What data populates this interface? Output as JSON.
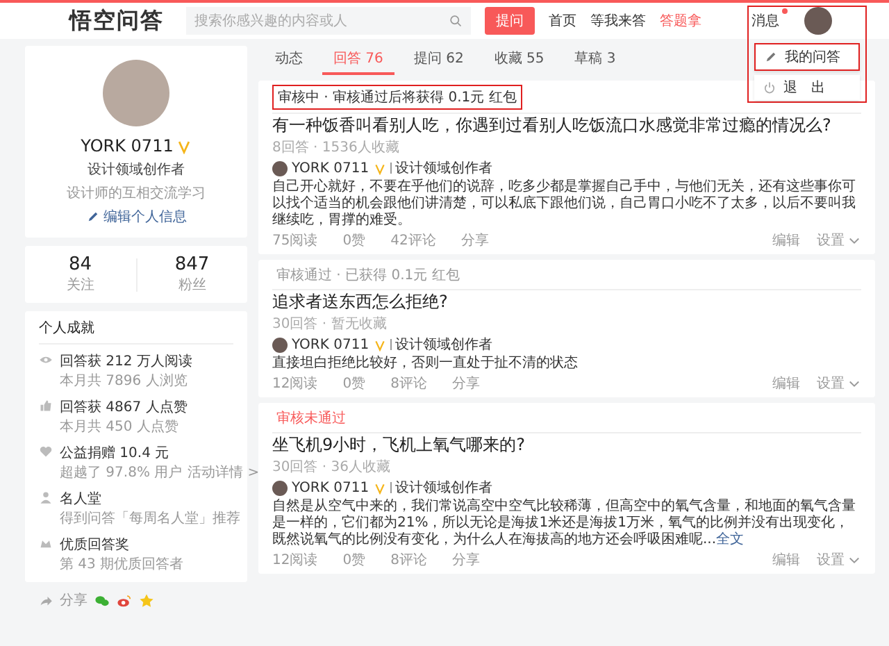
{
  "header": {
    "logo": "悟空问答",
    "search": {
      "placeholder": "搜索你感兴趣的内容或人"
    },
    "ask_button": "提问",
    "nav": [
      {
        "label": "首页",
        "highlight": false
      },
      {
        "label": "等我来答",
        "highlight": false
      },
      {
        "label": "答题拿",
        "highlight": true
      }
    ],
    "messages": {
      "label": "消息",
      "unread": true
    }
  },
  "user_menu": {
    "annotated": true,
    "items": [
      {
        "kind": "edit",
        "label": "我的问答",
        "annotated": true
      },
      {
        "kind": "logout",
        "label": "退　出",
        "annotated": false
      }
    ]
  },
  "profile": {
    "name": "YORK 0711",
    "verified": true,
    "title": "设计领域创作者",
    "bio": "设计师的互相交流学习",
    "edit_link": "编辑个人信息"
  },
  "stats": [
    {
      "value": "84",
      "label": "关注"
    },
    {
      "value": "847",
      "label": "粉丝"
    }
  ],
  "achievements": {
    "title": "个人成就",
    "items": [
      {
        "kind": "eye",
        "title": "回答获 212 万人阅读",
        "detail": "本月共 7896 人浏览"
      },
      {
        "kind": "thumb",
        "title": "回答获 4867 人点赞",
        "detail": "本月共 450 人点赞"
      },
      {
        "kind": "heart",
        "title": "公益捐赠 10.4 元",
        "detail": "超越了 97.8% 用户",
        "link": "活动详情 >"
      },
      {
        "kind": "person",
        "title": "名人堂",
        "detail": "得到问答「每周名人堂」推荐"
      },
      {
        "kind": "medal",
        "title": "优质回答奖",
        "detail": "第 43 期优质回答者"
      }
    ]
  },
  "share": {
    "label": "分享"
  },
  "tabs": [
    {
      "label": "动态",
      "selected": false
    },
    {
      "label": "回答 76",
      "selected": true
    },
    {
      "label": "提问 62",
      "selected": false
    },
    {
      "label": "收藏 55",
      "selected": false
    },
    {
      "label": "草稿 3",
      "selected": false
    }
  ],
  "answers": [
    {
      "status": {
        "kind": "pending",
        "text": "审核中 · 审核通过后将获得 0.1元 红包",
        "annotated": true
      },
      "title": "有一种饭香叫看别人吃，你遇到过看别人吃饭流口水感觉非常过瘾的情况么?",
      "meta": "8回答 · 1536人收藏",
      "author": "YORK 0711",
      "verified": true,
      "role": "设计领域创作者",
      "body": "自己开心就好，不要在乎他们的说辞，吃多少都是掌握自己手中，与他们无关，还有这些事你可以找个适当的机会跟他们讲清楚，可以私底下跟他们说，自己胃口小吃不了太多，以后不要叫我继续吃，胃撑的难受。",
      "actions": [
        "75阅读",
        "0赞",
        "42评论",
        "分享"
      ],
      "tools": [
        "编辑",
        "设置"
      ]
    },
    {
      "status": {
        "kind": "approved",
        "text": "审核通过 · 已获得 0.1元 红包",
        "annotated": false
      },
      "title": "追求者送东西怎么拒绝?",
      "meta": "30回答 · 暂无收藏",
      "author": "YORK 0711",
      "verified": true,
      "role": "设计领域创作者",
      "body": "直接坦白拒绝比较好，否则一直处于扯不清的状态",
      "actions": [
        "12阅读",
        "0赞",
        "8评论",
        "分享"
      ],
      "tools": [
        "编辑",
        "设置"
      ]
    },
    {
      "status": {
        "kind": "rejected",
        "text": "审核未通过",
        "annotated": false
      },
      "title": "坐飞机9小时，飞机上氧气哪来的?",
      "meta": "30回答 · 36人收藏",
      "author": "YORK 0711",
      "verified": true,
      "role": "设计领域创作者",
      "body": "自然是从空气中来的，我们常说高空中空气比较稀薄，但高空中的氧气含量，和地面的氧气含量是一样的，它们都为21%，所以无论是海拔1米还是海拔1万米，氧气的比例并没有出现变化，既然说氧气的比例没有变化，为什么人在海拔高的地方还会呼吸困难呢...",
      "more_link": "全文",
      "actions": [
        "12阅读",
        "0赞",
        "8评论",
        "分享"
      ],
      "tools": [
        "编辑",
        "设置"
      ]
    }
  ]
}
